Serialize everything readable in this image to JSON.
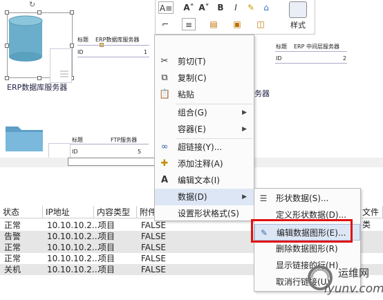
{
  "canvas": {
    "erp_db": {
      "caption": "ERP数据库服务器",
      "header_title": "标题",
      "header_value": "ERP数据库服务器",
      "id_label": "ID",
      "id_value": "1"
    },
    "erp_mid": {
      "header_title": "标题",
      "header_value": "ERP 中间层服务器",
      "id_label": "ID",
      "id_value": "2",
      "caption_partial": "务器"
    },
    "ftp": {
      "header_title": "标题",
      "header_value": "FTP服务器",
      "id_label": "ID",
      "id_value": "5"
    }
  },
  "ribbon": {
    "style_label": "样式"
  },
  "table": {
    "headers": [
      "状态",
      "IP地址",
      "内容类型",
      "附件",
      "文件类"
    ],
    "rows": [
      {
        "status": "正常",
        "ip": "10.10.10.2...",
        "type": "项目",
        "attach": "FALSE"
      },
      {
        "status": "告警",
        "ip": "10.10.10.2...",
        "type": "项目",
        "attach": "FALSE"
      },
      {
        "status": "正常",
        "ip": "10.10.10.2...",
        "type": "项目",
        "attach": "FALSE"
      },
      {
        "status": "正常",
        "ip": "10.10.10.2...",
        "type": "项目",
        "attach": "FALSE"
      },
      {
        "status": "关机",
        "ip": "10.10.10.2...",
        "type": "项目",
        "attach": "FALSE"
      }
    ]
  },
  "context_menu": {
    "items": [
      {
        "label": "剪切(T)",
        "icon": "scissors-icon"
      },
      {
        "label": "复制(C)",
        "icon": "copy-icon"
      },
      {
        "label": "粘贴",
        "icon": "paste-icon"
      },
      {
        "label": "组合(G)",
        "icon": ""
      },
      {
        "label": "容器(E)",
        "icon": ""
      },
      {
        "label": "超链接(Y)...",
        "icon": "hyperlink-icon"
      },
      {
        "label": "添加注释(A)",
        "icon": "comment-icon"
      },
      {
        "label": "编辑文本(I)",
        "icon": "text-icon"
      },
      {
        "label": "数据(D)",
        "icon": ""
      },
      {
        "label": "设置形状格式(S)",
        "icon": ""
      }
    ]
  },
  "data_submenu": {
    "items": [
      {
        "label": "形状数据(S)...",
        "icon": "shape-data-icon"
      },
      {
        "label": "定义形状数据(D)...",
        "icon": ""
      },
      {
        "label": "编辑数据图形(E)...",
        "icon": "edit-data-graphic-icon"
      },
      {
        "label": "删除数据图形(R)",
        "icon": ""
      },
      {
        "label": "显示链接的行(H)",
        "icon": ""
      },
      {
        "label": "取消行链接(U)",
        "icon": ""
      }
    ]
  },
  "watermark": {
    "name": "运维网",
    "domain": "iyunv.com"
  }
}
